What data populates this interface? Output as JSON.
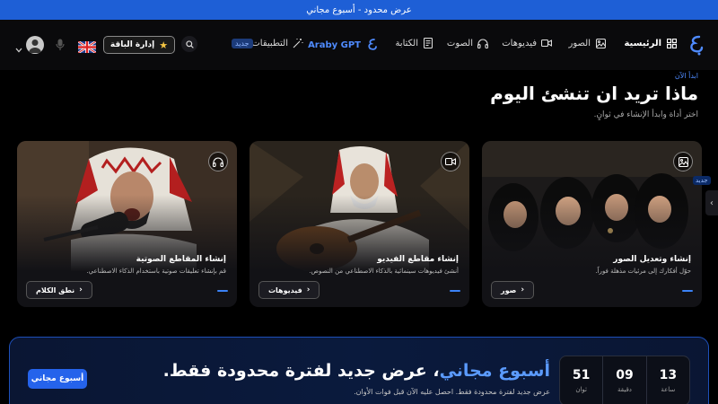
{
  "banner": {
    "text": "عرض محدود - أسبوع مجاني"
  },
  "nav": {
    "items": [
      {
        "label": "الرئيسية",
        "icon": "grid-icon"
      },
      {
        "label": "الصور",
        "icon": "image-icon"
      },
      {
        "label": "فيديوهات",
        "icon": "video-icon"
      },
      {
        "label": "الصوت",
        "icon": "headphones-icon"
      },
      {
        "label": "الكتابة",
        "icon": "document-icon"
      },
      {
        "label": "التطبيقات",
        "icon": "magic-wand-icon"
      }
    ],
    "araby_label": "Araby GPT",
    "new_badge": "جديد",
    "plan_button": "إدارة الباقة",
    "language_flag": "uk-flag-icon"
  },
  "hero": {
    "kicker": "ابدأ الآن",
    "title": "ماذا تريد ان تنشئ اليوم",
    "subtitle": "اختر أداة وابدأ الإنشاء في ثوانٍ."
  },
  "cards": [
    {
      "title": "إنشاء وتعديل الصور",
      "desc": "حوّل أفكارك إلى مرئيات مذهلة فوراً.",
      "button": "صور",
      "icon": "image-icon"
    },
    {
      "title": "إنشاء مقاطع الفيديو",
      "desc": "أنشئ فيديوهات سينمائية بالذكاء الاصطناعي من النصوص.",
      "button": "فيديوهات",
      "icon": "video-icon"
    },
    {
      "title": "إنشاء المقاطع الصوتية",
      "desc": "قم بإنشاء تعليقات صوتية باستخدام الذكاء الاصطناعي.",
      "button": "نطق الكلام",
      "icon": "headphones-icon"
    }
  ],
  "side_tab": "جديد",
  "promo": {
    "title_highlight": "أسبوع مجاني",
    "title_rest": "، عرض جديد لفترة محدودة فقط.",
    "desc": "عرض جديد لفترة محدودة فقط. احصل عليه الآن قبل فوات الأوان.",
    "button": "أسبوع مجاني",
    "timer": [
      {
        "value": "51",
        "label": "ثوان"
      },
      {
        "value": "09",
        "label": "دقيقة"
      },
      {
        "value": "13",
        "label": "ساعة"
      }
    ]
  },
  "colors": {
    "accent": "#2563eb",
    "banner": "#1e5fd6",
    "link": "#4f8bff"
  }
}
